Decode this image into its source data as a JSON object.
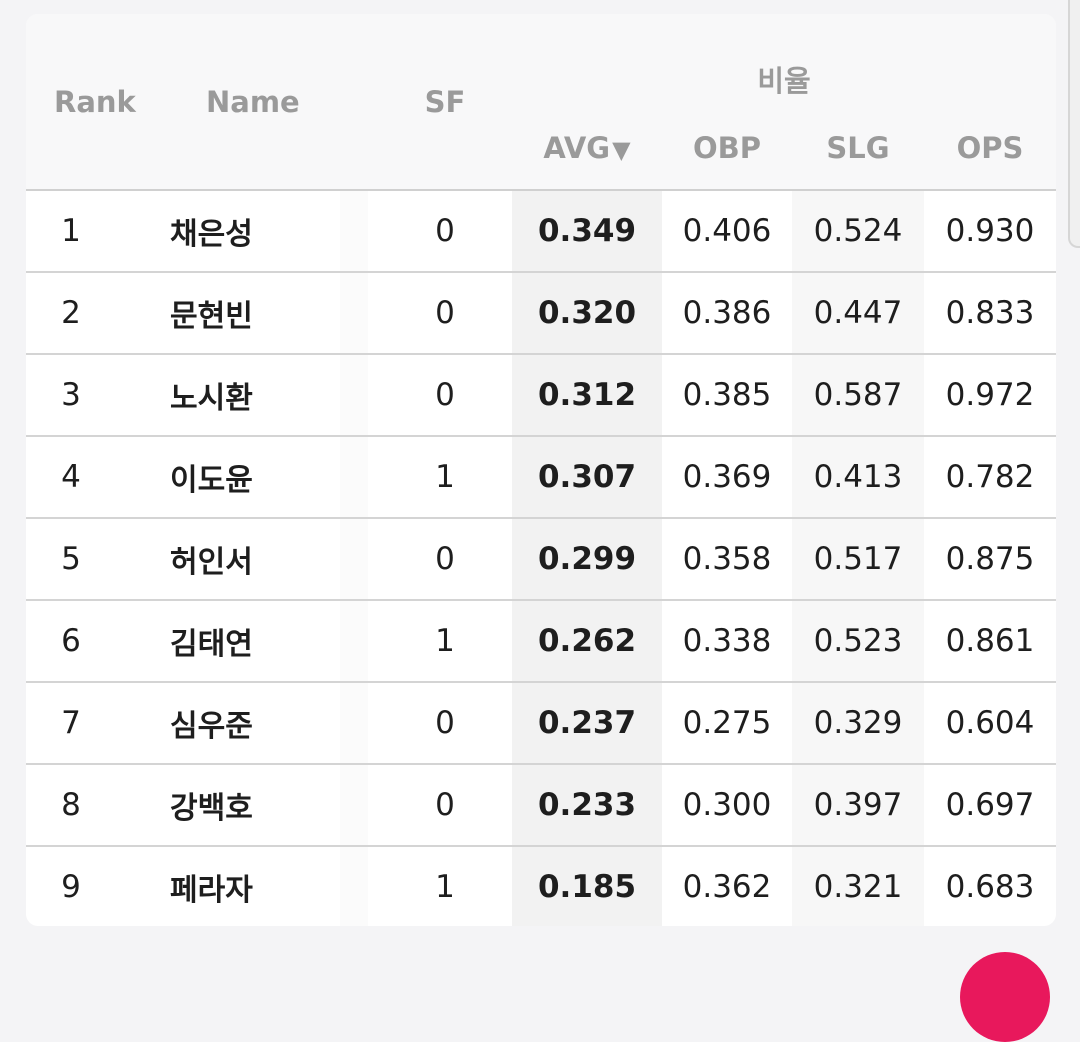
{
  "header": {
    "rank": "Rank",
    "name": "Name",
    "sf": "SF",
    "group_label": "비율",
    "avg": "AVG",
    "avg_sort_indicator": "▼",
    "obp": "OBP",
    "slg": "SLG",
    "ops": "OPS"
  },
  "rows": [
    {
      "rank": "1",
      "name": "채은성",
      "sf": "0",
      "avg": "0.349",
      "obp": "0.406",
      "slg": "0.524",
      "ops": "0.930"
    },
    {
      "rank": "2",
      "name": "문현빈",
      "sf": "0",
      "avg": "0.320",
      "obp": "0.386",
      "slg": "0.447",
      "ops": "0.833"
    },
    {
      "rank": "3",
      "name": "노시환",
      "sf": "0",
      "avg": "0.312",
      "obp": "0.385",
      "slg": "0.587",
      "ops": "0.972"
    },
    {
      "rank": "4",
      "name": "이도윤",
      "sf": "1",
      "avg": "0.307",
      "obp": "0.369",
      "slg": "0.413",
      "ops": "0.782"
    },
    {
      "rank": "5",
      "name": "허인서",
      "sf": "0",
      "avg": "0.299",
      "obp": "0.358",
      "slg": "0.517",
      "ops": "0.875"
    },
    {
      "rank": "6",
      "name": "김태연",
      "sf": "1",
      "avg": "0.262",
      "obp": "0.338",
      "slg": "0.523",
      "ops": "0.861"
    },
    {
      "rank": "7",
      "name": "심우준",
      "sf": "0",
      "avg": "0.237",
      "obp": "0.275",
      "slg": "0.329",
      "ops": "0.604"
    },
    {
      "rank": "8",
      "name": "강백호",
      "sf": "0",
      "avg": "0.233",
      "obp": "0.300",
      "slg": "0.397",
      "ops": "0.697"
    },
    {
      "rank": "9",
      "name": "페라자",
      "sf": "1",
      "avg": "0.185",
      "obp": "0.362",
      "slg": "0.321",
      "ops": "0.683"
    }
  ],
  "colors": {
    "fab": "#e8185c",
    "sorted_column_bg": "#f2f2f2",
    "header_text": "#9a9a9a"
  }
}
